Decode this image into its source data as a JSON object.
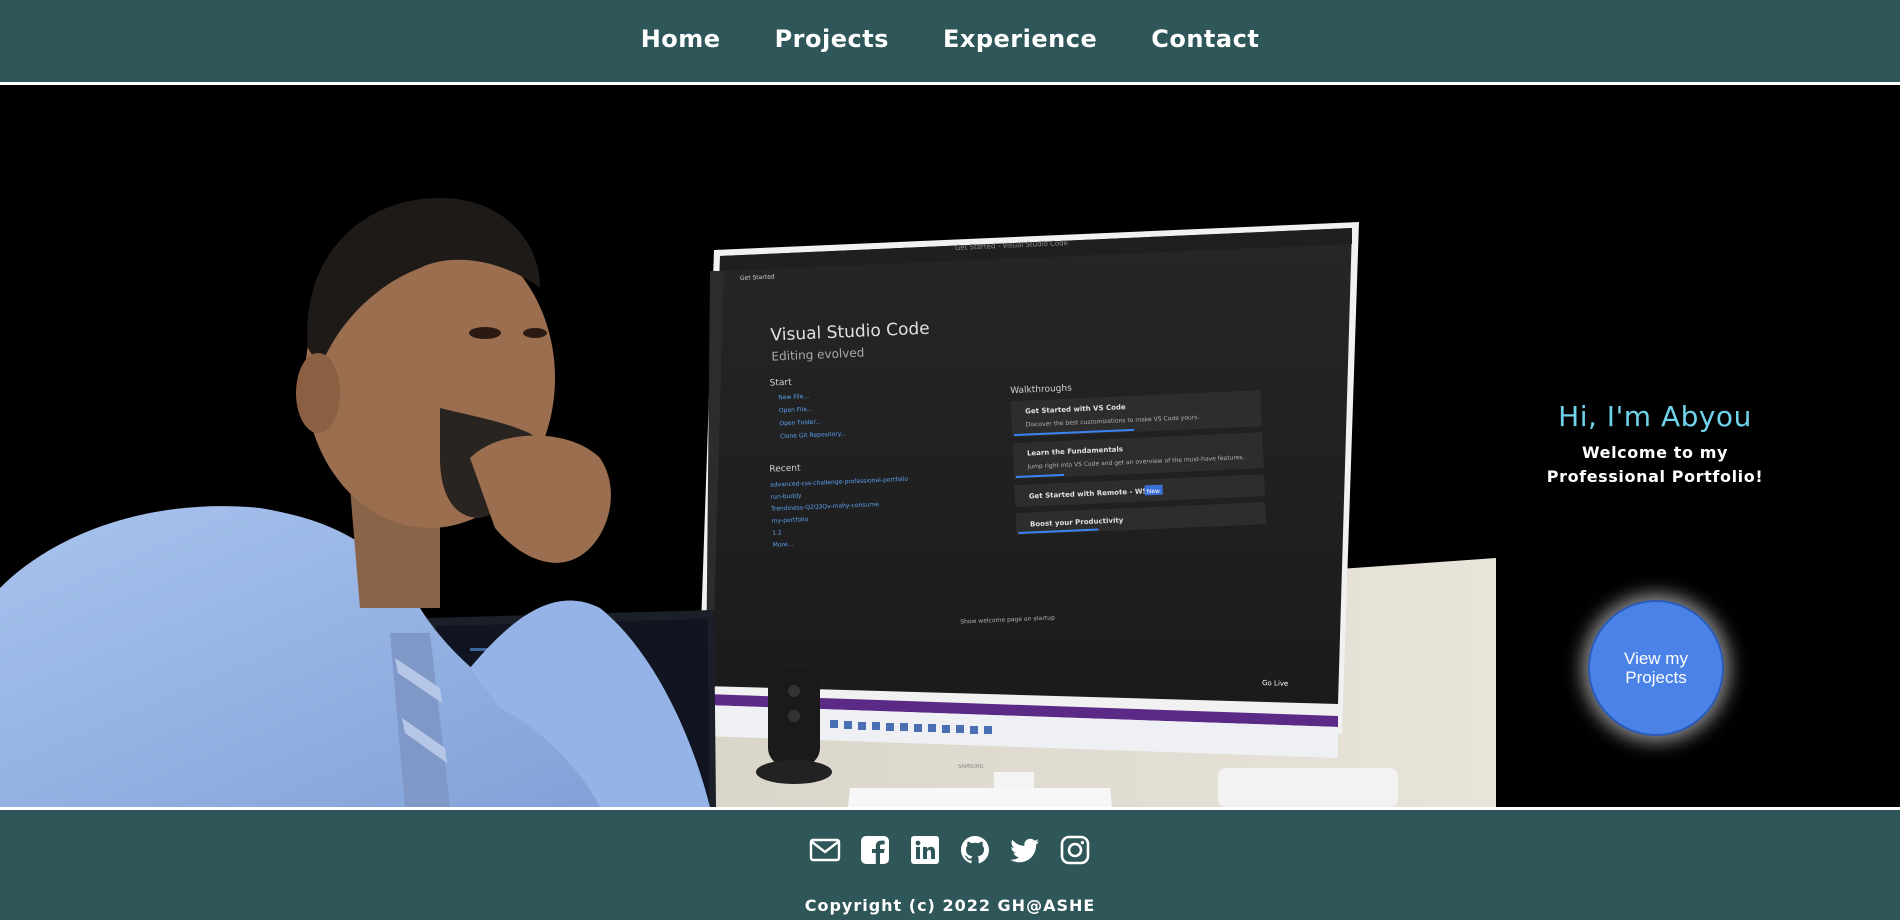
{
  "nav": {
    "items": [
      {
        "label": "Home"
      },
      {
        "label": "Projects"
      },
      {
        "label": "Experience"
      },
      {
        "label": "Contact"
      }
    ]
  },
  "hero": {
    "photo_alt": "Person at desk in front of a monitor showing Visual Studio Code",
    "greeting": "Hi, I'm Abyou",
    "subtitle": "Welcome to my Professional Portfolio!",
    "cta_label": "View my Projects",
    "monitor": {
      "app_title": "Visual Studio Code",
      "app_tagline": "Editing evolved",
      "window_title": "Get Started - Visual Studio Code",
      "tab_label": "Get Started",
      "start_heading": "Start",
      "start_items": [
        "New File...",
        "Open File...",
        "Open Folder...",
        "Clone Git Repository..."
      ],
      "recent_heading": "Recent",
      "recent_items": [
        "advanced-css-challenge-professional-portfolio",
        "run-buddy",
        "Trendiness-Q2Q3Qv-mahy-consume",
        "my-portfolio",
        "1.2"
      ],
      "recent_more": "More...",
      "walkthroughs_heading": "Walkthroughs",
      "walkthroughs": [
        {
          "title": "Get Started with VS Code",
          "desc": "Discover the best customizations to make VS Code yours."
        },
        {
          "title": "Learn the Fundamentals",
          "desc": "Jump right into VS Code and get an overview of the must-have features."
        },
        {
          "title": "Get Started with Remote - WSL",
          "desc": ""
        },
        {
          "title": "Boost your Productivity",
          "desc": ""
        }
      ],
      "new_badge": "New",
      "show_welcome": "Show welcome page on startup",
      "go_live": "Go Live",
      "monitor_brand": "SAMSUNG"
    }
  },
  "footer": {
    "social": [
      {
        "icon": "mail-icon"
      },
      {
        "icon": "facebook-icon"
      },
      {
        "icon": "linkedin-icon"
      },
      {
        "icon": "github-icon"
      },
      {
        "icon": "twitter-icon"
      },
      {
        "icon": "instagram-icon"
      }
    ],
    "copyright": "Copyright (c) 2022 GH@ASHE"
  },
  "colors": {
    "nav_bg": "#2f5659",
    "greeting": "#6fd3ea",
    "cta_bg": "#4b82e8"
  }
}
